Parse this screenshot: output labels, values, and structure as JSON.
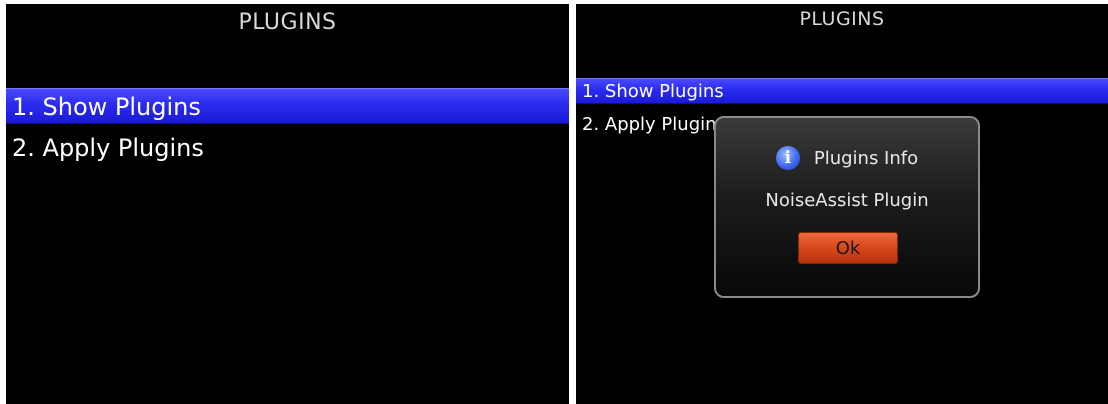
{
  "left_screen": {
    "title": "PLUGINS",
    "menu": [
      {
        "label": "1. Show Plugins",
        "selected": true
      },
      {
        "label": "2. Apply Plugins",
        "selected": false
      }
    ]
  },
  "right_screen": {
    "title": "PLUGINS",
    "menu": [
      {
        "label": "1. Show Plugins",
        "selected": true
      },
      {
        "label": "2. Apply Plugins",
        "selected": false
      }
    ],
    "dialog": {
      "icon": "info-icon",
      "icon_glyph": "i",
      "title": "Plugins Info",
      "message": "NoiseAssist Plugin",
      "ok_label": "Ok"
    }
  },
  "colors": {
    "selection": "#2b2bf0",
    "ok_button": "#d8461c",
    "background": "#000000"
  }
}
